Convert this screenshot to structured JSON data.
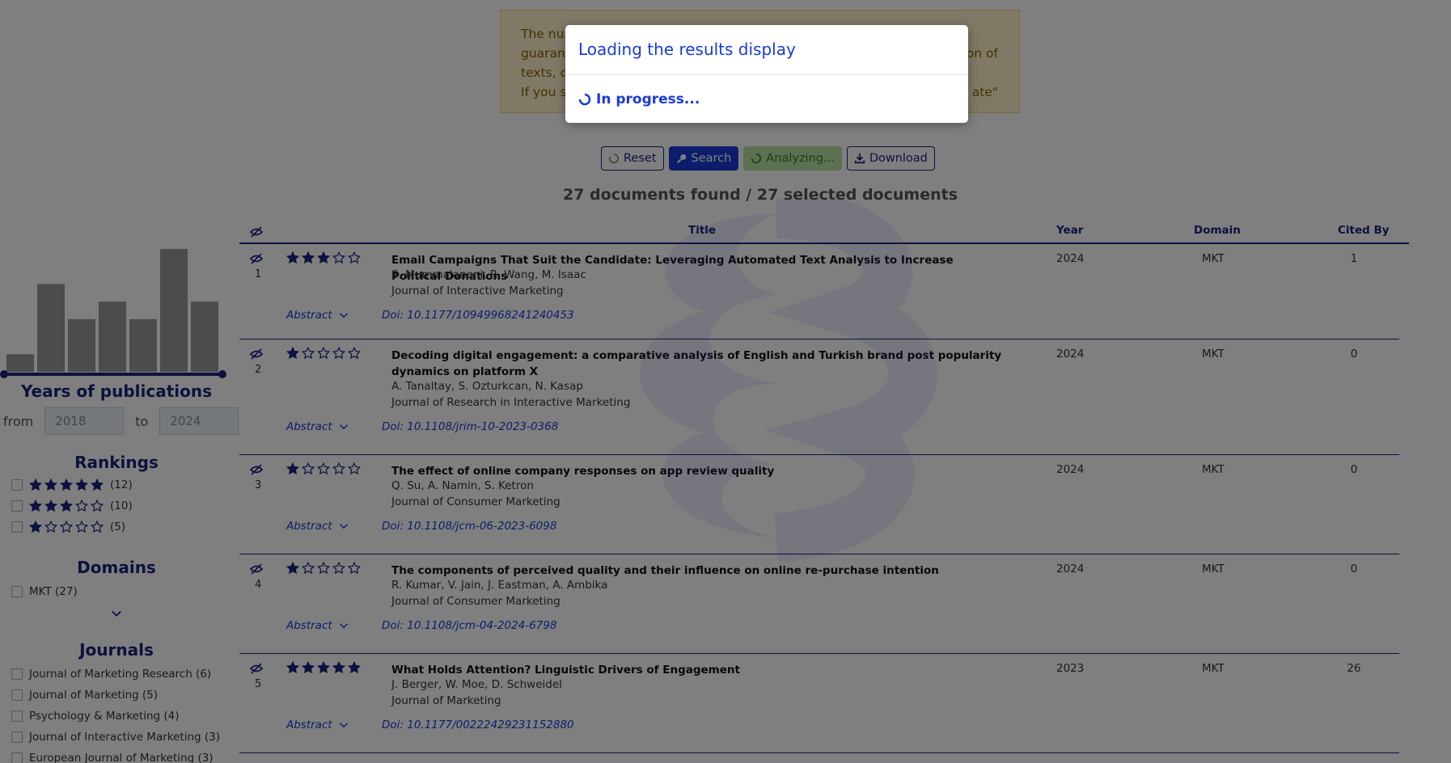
{
  "notice": {
    "lines": [
      "The nu",
      "guaran",
      "texts, c",
      "If you s"
    ],
    "right_lines": [
      "on of",
      "",
      "ate\""
    ]
  },
  "toolbar": {
    "reset_label": "Reset",
    "search_label": "Search",
    "analyzing_label": "Analyzing...",
    "download_label": "Download"
  },
  "results_summary": "27 documents found / 27 selected documents",
  "sidebar": {
    "years_title": "Years of publications",
    "from_label": "from",
    "to_label": "to",
    "from_value": "2018",
    "to_value": "2024",
    "histogram_values": [
      1,
      5,
      3,
      4,
      3,
      7,
      4
    ],
    "rankings_title": "Rankings",
    "rankings": [
      {
        "stars": 5,
        "count": "(12)"
      },
      {
        "stars": 3,
        "count": "(10)"
      },
      {
        "stars": 1,
        "count": "(5)"
      }
    ],
    "domains_title": "Domains",
    "domains": [
      {
        "label": "MKT (27)"
      }
    ],
    "journals_title": "Journals",
    "journals": [
      {
        "label": "Journal of Marketing Research (6)"
      },
      {
        "label": "Journal of Marketing (5)"
      },
      {
        "label": "Psychology & Marketing (4)"
      },
      {
        "label": "Journal of Interactive Marketing (3)"
      },
      {
        "label": "European Journal of Marketing (3)"
      }
    ]
  },
  "table": {
    "headers": {
      "title": "Title",
      "year": "Year",
      "domain": "Domain",
      "cited_by": "Cited By"
    },
    "abstract_label": "Abstract",
    "rows": [
      {
        "index": "1",
        "stars": 3,
        "title": "Email Campaigns That Suit the Candidate: Leveraging Automated Text Analysis to Increase Political Donations",
        "authors": "S. Mummalaneni, R. Wang, M. Isaac",
        "journal": "Journal of Interactive Marketing",
        "doi": "Doi: 10.1177/10949968241240453",
        "year": "2024",
        "domain": "MKT",
        "cited": "1"
      },
      {
        "index": "2",
        "stars": 1,
        "title": "Decoding digital engagement: a comparative analysis of English and Turkish brand post popularity dynamics on platform X",
        "authors": "A. Tanaltay, S. Ozturkcan, N. Kasap",
        "journal": "Journal of Research in Interactive Marketing",
        "doi": "Doi: 10.1108/jrim-10-2023-0368",
        "year": "2024",
        "domain": "MKT",
        "cited": "0"
      },
      {
        "index": "3",
        "stars": 1,
        "title": "The effect of online company responses on app review quality",
        "authors": "Q. Su, A. Namin, S. Ketron",
        "journal": "Journal of Consumer Marketing",
        "doi": "Doi: 10.1108/jcm-06-2023-6098",
        "year": "2024",
        "domain": "MKT",
        "cited": "0"
      },
      {
        "index": "4",
        "stars": 1,
        "title": "The components of perceived quality and their influence on online re-purchase intention",
        "authors": "R. Kumar, V. Jain, J. Eastman, A. Ambika",
        "journal": "Journal of Consumer Marketing",
        "doi": "Doi: 10.1108/jcm-04-2024-6798",
        "year": "2024",
        "domain": "MKT",
        "cited": "0"
      },
      {
        "index": "5",
        "stars": 5,
        "title": "What Holds Attention? Linguistic Drivers of Engagement",
        "authors": "J. Berger, W. Moe, D. Schweidel",
        "journal": "Journal of Marketing",
        "doi": "Doi: 10.1177/00222429231152880",
        "year": "2023",
        "domain": "MKT",
        "cited": "26"
      }
    ]
  },
  "modal": {
    "title": "Loading the results display",
    "status": "In progress..."
  },
  "colors": {
    "accent": "#1a3bd6",
    "navy": "#1a237e",
    "success": "#b6e3a3"
  }
}
